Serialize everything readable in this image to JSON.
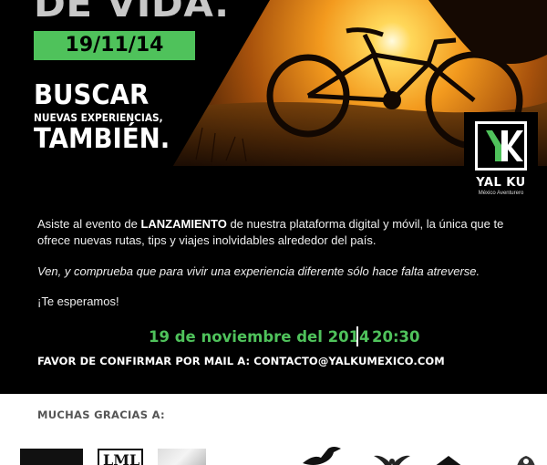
{
  "hero": {
    "headline_top": "DE VIDA.",
    "date_badge": "19/11/14",
    "headline_buscar": "BUSCAR",
    "headline_sub": "NUEVAS EXPERIENCIAS,",
    "headline_tambien": "TAMBIÉN."
  },
  "logo": {
    "name": "YAL KU",
    "tagline": "México Aventurero",
    "icon": "yalku-k-logo-icon"
  },
  "body": {
    "p1_before": "Asiste al evento de ",
    "p1_bold": "LANZAMIENTO",
    "p1_after": " de nuestra plataforma digital y móvil, la única que te ofrece nuevas rutas, tips y viajes inolvidables alrededor del país.",
    "p2": "Ven, y comprueba que para vivir una experiencia diferente sólo hace falta atreverse.",
    "p3": "¡Te esperamos!"
  },
  "event": {
    "date": "19 de noviembre del 2014",
    "time": "20:30",
    "rsvp": "FAVOR DE CONFIRMAR POR MAIL A: CONTACTO@YALKUMEXICO.COM"
  },
  "sponsors": {
    "title": "MUCHAS GRACIAS A:",
    "logos": [
      {
        "icon": "sponsor-black-logo-icon"
      },
      {
        "icon": "sponsor-lml-logo-icon",
        "text": "LML"
      },
      {
        "icon": "sponsor-grey-logo-icon"
      },
      {
        "icon": "sponsor-bird-logo-icon"
      },
      {
        "icon": "sponsor-wings-logo-icon"
      },
      {
        "icon": "sponsor-roof-logo-icon"
      },
      {
        "icon": "sponsor-crest-logo-icon"
      }
    ]
  },
  "colors": {
    "accent_green": "#4fc25b",
    "background": "#000000",
    "sponsor_band": "#ffffff",
    "sunset_orange": "#f39a1e"
  }
}
